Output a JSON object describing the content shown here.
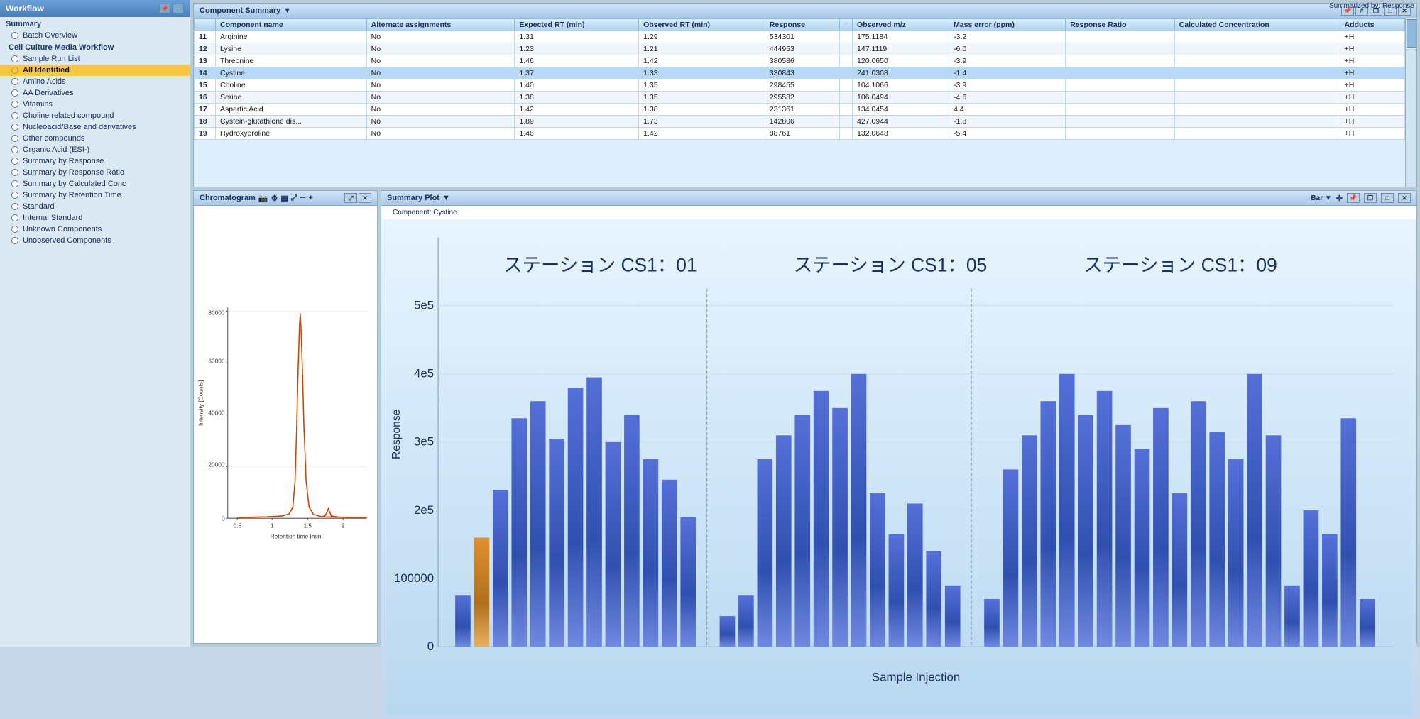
{
  "leftPanel": {
    "title": "Workflow",
    "sections": {
      "summary": {
        "label": "Summary",
        "items": [
          {
            "id": "batch-overview",
            "label": "Batch Overview",
            "active": false
          }
        ]
      },
      "cellCulture": {
        "label": "Cell Culture Media Workflow",
        "items": [
          {
            "id": "sample-run-list",
            "label": "Sample Run List",
            "active": false
          },
          {
            "id": "all-identified",
            "label": "All Identified",
            "active": true
          },
          {
            "id": "amino-acids",
            "label": "Amino Acids",
            "active": false
          },
          {
            "id": "aa-derivatives",
            "label": "AA Derivatives",
            "active": false
          },
          {
            "id": "vitamins",
            "label": "Vitamins",
            "active": false
          },
          {
            "id": "choline-related",
            "label": "Choline related compound",
            "active": false
          },
          {
            "id": "nucleoacid-base",
            "label": "Nucleoacid/Base and derivatives",
            "active": false
          },
          {
            "id": "other-compounds",
            "label": "Other compounds",
            "active": false
          },
          {
            "id": "organic-acid",
            "label": "Organic Acid (ESI-)",
            "active": false
          },
          {
            "id": "summary-response",
            "label": "Summary by Response",
            "active": false
          },
          {
            "id": "summary-response-ratio",
            "label": "Summary by Response Ratio",
            "active": false
          },
          {
            "id": "summary-calc-conc",
            "label": "Summary by Calculated Conc",
            "active": false
          },
          {
            "id": "summary-retention",
            "label": "Summary by Retention Time",
            "active": false
          },
          {
            "id": "standard",
            "label": "Standard",
            "active": false
          },
          {
            "id": "internal-standard",
            "label": "Internal Standard",
            "active": false
          },
          {
            "id": "unknown-components",
            "label": "Unknown Components",
            "active": false
          },
          {
            "id": "unobserved-components",
            "label": "Unobserved Components",
            "active": false
          }
        ]
      }
    }
  },
  "componentSummary": {
    "title": "Component Summary",
    "columns": [
      "",
      "Component name",
      "Alternate assignments",
      "Expected RT (min)",
      "Observed RT (min)",
      "Response",
      "↑",
      "Observed m/z",
      "Mass error (ppm)",
      "Response Ratio",
      "Calculated Concentration",
      "Adducts"
    ],
    "rows": [
      {
        "num": 11,
        "name": "Arginine",
        "alternate": "No",
        "expectedRT": "1.31",
        "observedRT": "1.29",
        "response": "534301",
        "arrow": "",
        "observedMZ": "175.1184",
        "massError": "-3.2",
        "responseRatio": "",
        "calcConc": "",
        "adducts": "+H",
        "selected": false
      },
      {
        "num": 12,
        "name": "Lysine",
        "alternate": "No",
        "expectedRT": "1.23",
        "observedRT": "1.21",
        "response": "444953",
        "arrow": "",
        "observedMZ": "147.1119",
        "massError": "-6.0",
        "responseRatio": "",
        "calcConc": "",
        "adducts": "+H",
        "selected": false
      },
      {
        "num": 13,
        "name": "Threonine",
        "alternate": "No",
        "expectedRT": "1.46",
        "observedRT": "1.42",
        "response": "380586",
        "arrow": "",
        "observedMZ": "120.0650",
        "massError": "-3.9",
        "responseRatio": "",
        "calcConc": "",
        "adducts": "+H",
        "selected": false
      },
      {
        "num": 14,
        "name": "Cystine",
        "alternate": "No",
        "expectedRT": "1.37",
        "observedRT": "1.33",
        "response": "330843",
        "arrow": "",
        "observedMZ": "241.0308",
        "massError": "-1.4",
        "responseRatio": "",
        "calcConc": "",
        "adducts": "+H",
        "selected": true
      },
      {
        "num": 15,
        "name": "Choline",
        "alternate": "No",
        "expectedRT": "1.40",
        "observedRT": "1.35",
        "response": "298455",
        "arrow": "",
        "observedMZ": "104.1066",
        "massError": "-3.9",
        "responseRatio": "",
        "calcConc": "",
        "adducts": "+H",
        "selected": false
      },
      {
        "num": 16,
        "name": "Serine",
        "alternate": "No",
        "expectedRT": "1.38",
        "observedRT": "1.35",
        "response": "295582",
        "arrow": "",
        "observedMZ": "106.0494",
        "massError": "-4.6",
        "responseRatio": "",
        "calcConc": "",
        "adducts": "+H",
        "selected": false
      },
      {
        "num": 17,
        "name": "Aspartic Acid",
        "alternate": "No",
        "expectedRT": "1.42",
        "observedRT": "1.38",
        "response": "231361",
        "arrow": "",
        "observedMZ": "134.0454",
        "massError": "4.4",
        "responseRatio": "",
        "calcConc": "",
        "adducts": "+H",
        "selected": false
      },
      {
        "num": 18,
        "name": "Cystein-glutathione dis...",
        "alternate": "No",
        "expectedRT": "1.89",
        "observedRT": "1.73",
        "response": "142806",
        "arrow": "",
        "observedMZ": "427.0944",
        "massError": "-1.8",
        "responseRatio": "",
        "calcConc": "",
        "adducts": "+H",
        "selected": false
      },
      {
        "num": 19,
        "name": "Hydroxyproline",
        "alternate": "No",
        "expectedRT": "1.46",
        "observedRT": "1.42",
        "response": "88761",
        "arrow": "",
        "observedMZ": "132.0648",
        "massError": "-5.4",
        "responseRatio": "",
        "calcConc": "",
        "adducts": "+H",
        "selected": false
      }
    ]
  },
  "chromatogram": {
    "title": "Chromatogram",
    "xLabel": "Retention time [min]",
    "yLabel": "Intensity [Counts]",
    "xMin": 0.5,
    "xMax": 2.5,
    "yMax": 80000,
    "yTicks": [
      0,
      20000,
      40000,
      60000,
      80000
    ],
    "peakX": 1.33,
    "peakHeight": 0.95
  },
  "summaryPlot": {
    "title": "Summary Plot",
    "component": "Component: Cystine",
    "summarizedBy": "Summarized by: Response",
    "xLabel": "Sample Injection",
    "yLabel": "Response",
    "yTicks": [
      "0",
      "100000",
      "2e5",
      "3e5",
      "4e5",
      "5e5"
    ],
    "stations": [
      {
        "label": "ステーション CS1：01",
        "bars": [
          15,
          32,
          46,
          67,
          72,
          61,
          76,
          79,
          60,
          68,
          55,
          49,
          38
        ]
      },
      {
        "label": "ステーション CS1：05",
        "bars": [
          9,
          15,
          55,
          62,
          68,
          75,
          70,
          80,
          45,
          33,
          42,
          28,
          18
        ]
      },
      {
        "label": "ステーション CS1：09",
        "bars": [
          14,
          52,
          62,
          72,
          80,
          68,
          75,
          65,
          58,
          70,
          45,
          72,
          63,
          55,
          80,
          62
        ]
      }
    ],
    "highlightBarIndex": 1
  },
  "icons": {
    "dropdown": "▼",
    "minimize": "─",
    "maximize": "□",
    "close": "✕",
    "restore": "❐",
    "pin": "📌",
    "scroll": "◆",
    "camera": "📷",
    "settings": "⚙",
    "refresh": "↺",
    "expand": "+",
    "crosshair": "✛",
    "move": "⤢"
  }
}
